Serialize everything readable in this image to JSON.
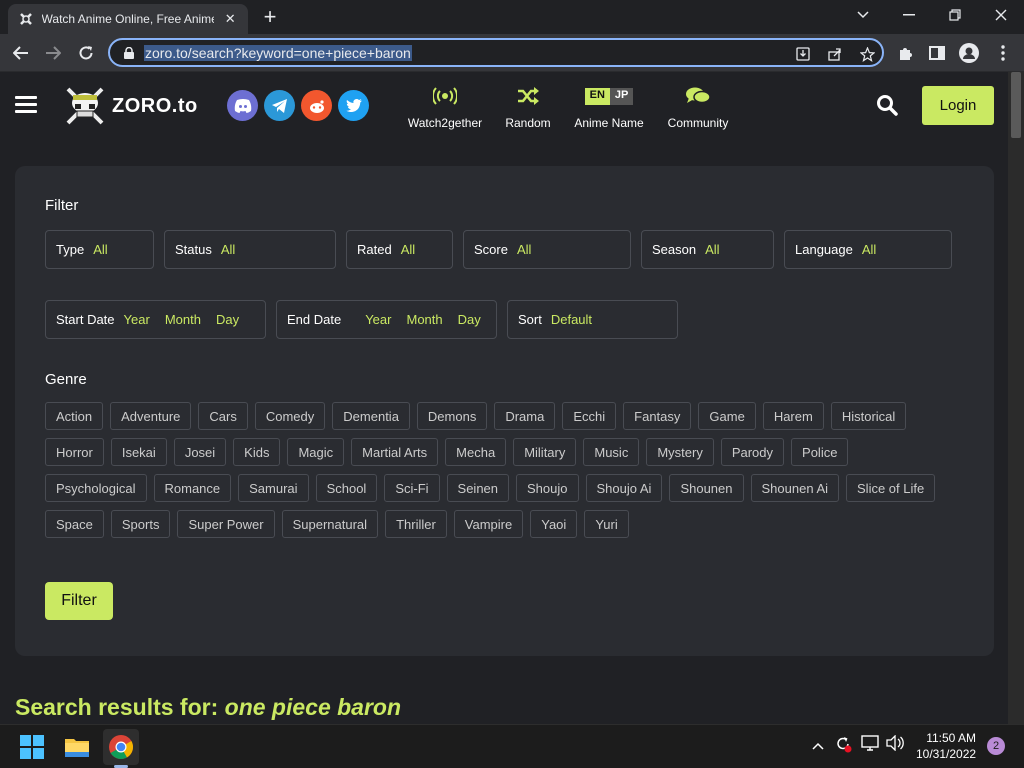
{
  "browser": {
    "tab_title": "Watch Anime Online, Free Anime",
    "tab_close": "✕",
    "new_tab": "+",
    "url": "zoro.to/search?keyword=one+piece+baron"
  },
  "site": {
    "logo_text": "ZORO.to",
    "nav": [
      {
        "label": "Watch2gether",
        "icon": "broadcast-icon"
      },
      {
        "label": "Random",
        "icon": "shuffle-icon"
      },
      {
        "label": "Anime Name",
        "icon": "en-jp-toggle"
      },
      {
        "label": "Community",
        "icon": "chat-icon"
      }
    ],
    "lang_toggle": {
      "en": "EN",
      "jp": "JP"
    },
    "login_label": "Login"
  },
  "filter": {
    "title": "Filter",
    "fields": [
      {
        "label": "Type",
        "value": "All"
      },
      {
        "label": "Status",
        "value": "All"
      },
      {
        "label": "Rated",
        "value": "All"
      },
      {
        "label": "Score",
        "value": "All"
      },
      {
        "label": "Season",
        "value": "All"
      },
      {
        "label": "Language",
        "value": "All"
      }
    ],
    "start_date": {
      "label": "Start Date",
      "year": "Year",
      "month": "Month",
      "day": "Day"
    },
    "end_date": {
      "label": "End Date",
      "year": "Year",
      "month": "Month",
      "day": "Day"
    },
    "sort": {
      "label": "Sort",
      "value": "Default"
    },
    "genre_title": "Genre",
    "genres": [
      "Action",
      "Adventure",
      "Cars",
      "Comedy",
      "Dementia",
      "Demons",
      "Drama",
      "Ecchi",
      "Fantasy",
      "Game",
      "Harem",
      "Historical",
      "Horror",
      "Isekai",
      "Josei",
      "Kids",
      "Magic",
      "Martial Arts",
      "Mecha",
      "Military",
      "Music",
      "Mystery",
      "Parody",
      "Police",
      "Psychological",
      "Romance",
      "Samurai",
      "School",
      "Sci-Fi",
      "Seinen",
      "Shoujo",
      "Shoujo Ai",
      "Shounen",
      "Shounen Ai",
      "Slice of Life",
      "Space",
      "Sports",
      "Super Power",
      "Supernatural",
      "Thriller",
      "Vampire",
      "Yaoi",
      "Yuri"
    ],
    "button_label": "Filter"
  },
  "results": {
    "prefix": "Search results for:",
    "query": "one piece baron"
  },
  "taskbar": {
    "time": "11:50 AM",
    "date": "10/31/2022",
    "notifications": "2"
  },
  "colors": {
    "accent": "#cae962",
    "background": "#202125",
    "panel": "#2a2c31"
  }
}
